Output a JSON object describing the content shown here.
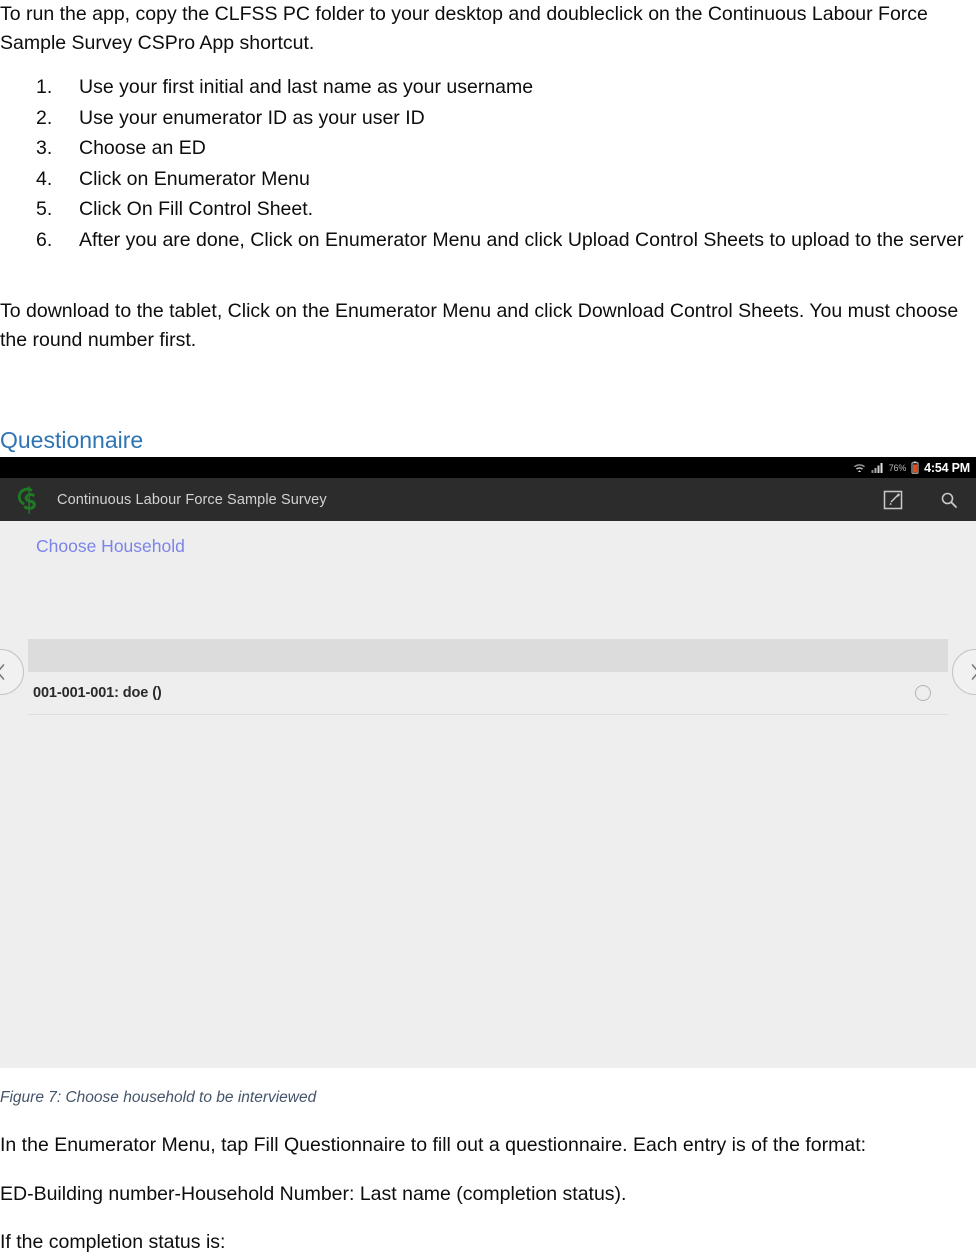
{
  "document": {
    "intro_paragraph": "To run the app, copy the CLFSS PC folder to your desktop and doubleclick on the Continuous Labour Force Sample Survey CSPro App shortcut.",
    "steps": [
      {
        "number": "1.",
        "text": "Use your first initial and last name as your username"
      },
      {
        "number": "2.",
        "text": "Use your enumerator ID as your user ID"
      },
      {
        "number": "3.",
        "text": "Choose an ED"
      },
      {
        "number": "4.",
        "text": "Click on Enumerator Menu"
      },
      {
        "number": "5.",
        "text": "Click On Fill Control Sheet."
      },
      {
        "number": "6.",
        "text": "After you are done, Click on Enumerator Menu and click Upload Control Sheets to upload to the server"
      }
    ],
    "download_paragraph": "To download to the tablet, Click on the Enumerator Menu and click Download Control Sheets. You must choose the round number first.",
    "section_heading": "Questionnaire",
    "heading_color": "#2e74b5",
    "figure_caption": "Figure 7: Choose household to be interviewed",
    "caption_color": "#44546a",
    "paragraph_enumerator_menu": "In the Enumerator Menu, tap Fill Questionnaire to fill out a questionnaire. Each entry is of the format:",
    "paragraph_format": "ED-Building number-Household Number: Last name (completion status).",
    "paragraph_status": "If the completion status is:"
  },
  "screenshot": {
    "status_bar": {
      "wifi_icon": "wifi-icon",
      "signal_icon": "signal-bars-icon",
      "battery_percent": "76%",
      "battery_icon": "battery-icon",
      "battery_color": "#e04b20",
      "clock": "4:54 PM",
      "background": "#000000"
    },
    "app_bar": {
      "logo_icon": "cs-monogram-logo",
      "logo_color": "#1f7a24",
      "title": "Continuous Labour Force Sample Survey",
      "title_color": "#d2d2d2",
      "background": "#2c2c2c",
      "actions": [
        {
          "icon": "compose-edit-icon",
          "label": "Compose"
        },
        {
          "icon": "search-icon",
          "label": "Search"
        }
      ]
    },
    "body": {
      "background": "#eeeeee",
      "section_title": "Choose Household",
      "section_title_color": "#7b84e8",
      "header_band_color": "#dcdcdc",
      "rows": [
        {
          "label": "001-001-001: doe ()",
          "selected": false,
          "radio_icon": "radio-unchecked-icon"
        }
      ],
      "nav_prev_icon": "chevron-left-icon",
      "nav_next_icon": "chevron-right-icon"
    }
  }
}
